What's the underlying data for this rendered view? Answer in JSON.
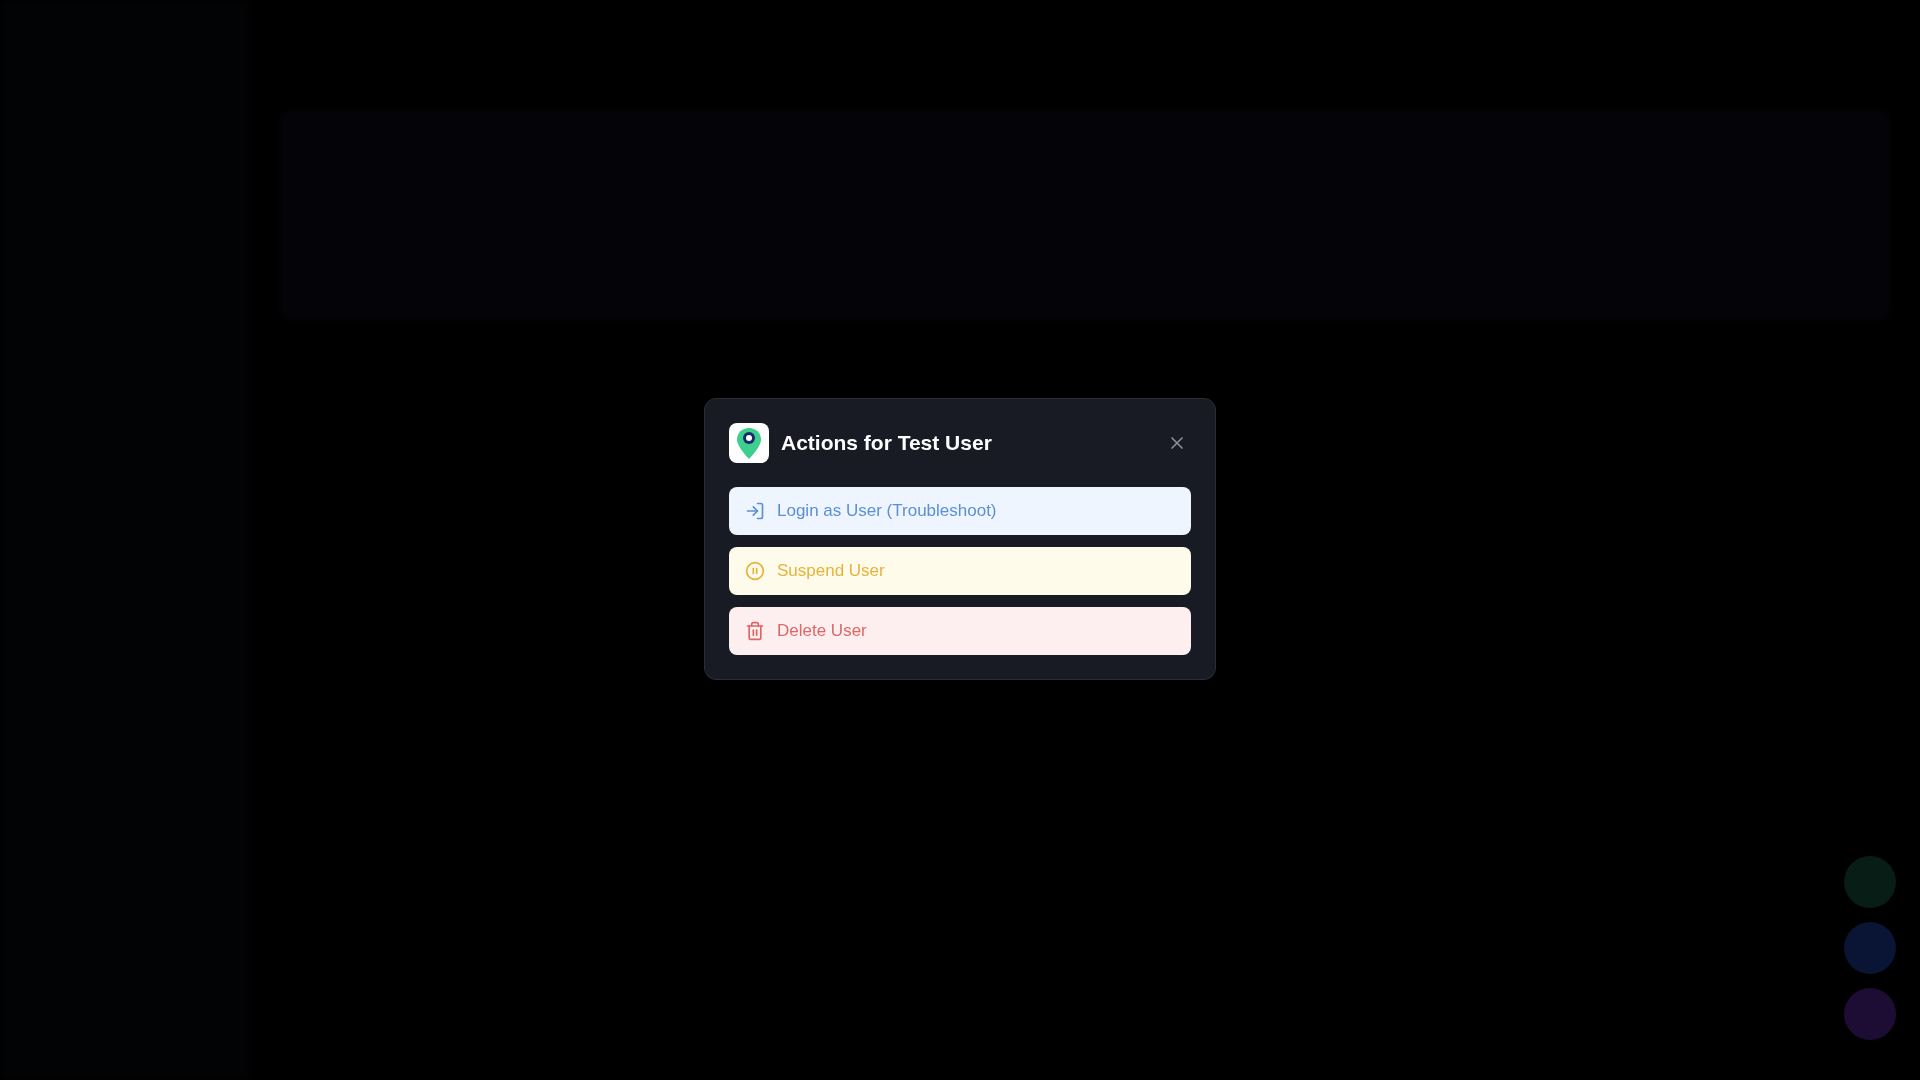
{
  "dialog": {
    "title": "Actions for Test User",
    "actions": [
      {
        "kind": "login",
        "label": "Login as User (Troubleshoot)"
      },
      {
        "kind": "suspend",
        "label": "Suspend User"
      },
      {
        "kind": "delete",
        "label": "Delete User"
      }
    ]
  }
}
